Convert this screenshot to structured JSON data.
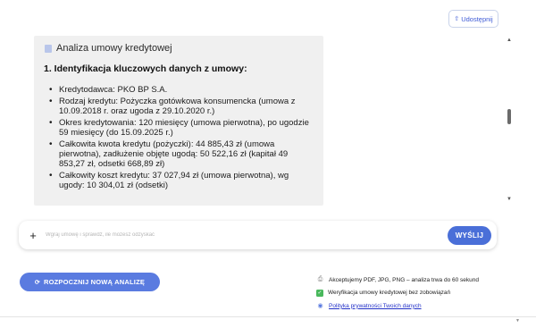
{
  "header": {
    "share_label": "Udostępnij"
  },
  "chat": {
    "document_name": "Analiza umowy kredytowej",
    "section_title": "1. Identyfikacja kluczowych danych z umowy:",
    "bullets": [
      "Kredytodawca: PKO BP S.A.",
      "Rodzaj kredytu: Pożyczka gotówkowa konsumencka (umowa z 10.09.2018 r. oraz ugoda z 29.10.2020 r.)",
      "Okres kredytowania: 120 miesięcy (umowa pierwotna), po ugodzie 59 miesięcy (do 15.09.2025 r.)",
      "Całkowita kwota kredytu (pożyczki): 44 885,43 zł (umowa pierwotna), zadłużenie objęte ugodą: 50 522,16 zł (kapitał 49 853,27 zł, odsetki 668,89 zł)",
      "Całkowity koszt kredytu: 37 027,94 zł (umowa pierwotna), wg ugody: 10 304,01 zł (odsetki)"
    ]
  },
  "composer": {
    "plus_label": "+",
    "placeholder": "Wgraj umowę i sprawdź, ile możesz odzyskać",
    "send_label": "WYŚLIJ"
  },
  "actions": {
    "new_analysis_label": "ROZPOCZNIJ NOWĄ ANALIZĘ"
  },
  "info": {
    "formats": "Akceptujemy PDF, JPG, PNG – analiza trwa do 60 sekund",
    "free_check": "Weryfikacja umowy kredytowej bez zobowiązań",
    "privacy": "Polityka prywatności Twoich danych"
  },
  "icons": {
    "share": "share-icon",
    "document": "document-icon",
    "plus": "plus-icon",
    "new_analysis": "refresh-icon",
    "formats": "paperclip-icon",
    "free_check": "check-icon",
    "privacy": "shield-icon"
  },
  "colors": {
    "accent": "#4a6fd8",
    "accent_light": "#5a7be0",
    "chat_bg": "#f0f0f0",
    "check": "#49b85c",
    "link": "#2432c8"
  }
}
